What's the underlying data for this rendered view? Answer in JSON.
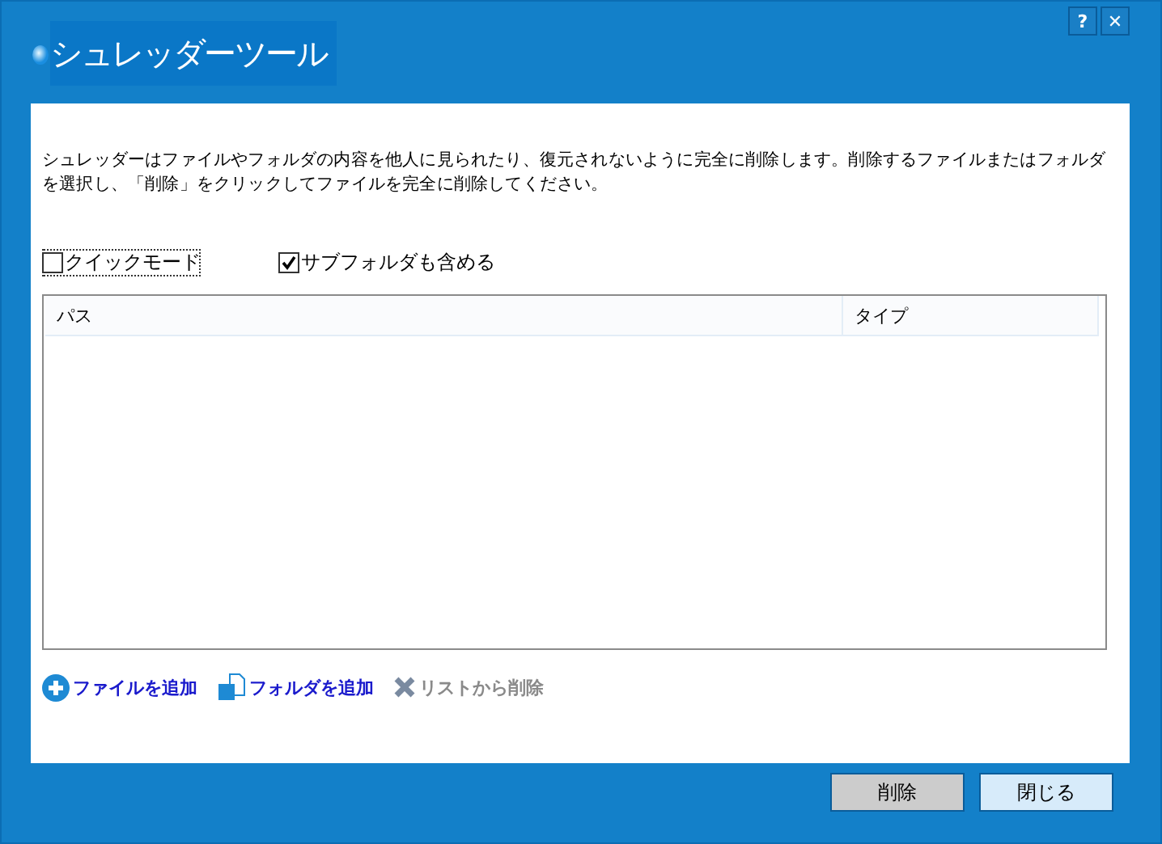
{
  "window": {
    "title": "シュレッダーツール",
    "controls": [
      "?",
      "✕"
    ]
  },
  "description": "シュレッダーはファイルやフォルダの内容を他人に見られたり、復元されないように完全に削除します。削除するファイルまたはフォルダを選択し、「削除」をクリックしてファイルを完全に削除してください。",
  "options": [
    {
      "label": "クイックモード",
      "checked": false,
      "focused": true
    },
    {
      "label": "サブフォルダも含める",
      "checked": true,
      "focused": false
    }
  ],
  "table": {
    "columns": [
      "パス",
      "タイプ"
    ]
  },
  "actions": [
    {
      "kind": "add-file",
      "label": "ファイルを追加",
      "disabled": false
    },
    {
      "kind": "add-folder",
      "label": "フォルダを追加",
      "disabled": false
    },
    {
      "kind": "remove",
      "label": "リストから削除",
      "disabled": true
    }
  ],
  "buttons": [
    {
      "label": "削除",
      "focused": false
    },
    {
      "label": "閉じる",
      "focused": true
    }
  ]
}
